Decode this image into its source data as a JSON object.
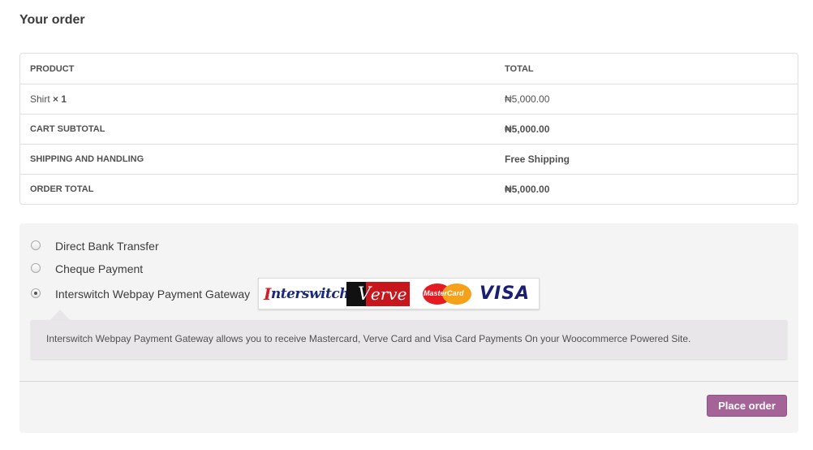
{
  "heading": "Your order",
  "table": {
    "header": {
      "product": "PRODUCT",
      "total": "TOTAL"
    },
    "item": {
      "name": "Shirt",
      "qty": "× 1",
      "total": "₦5,000.00"
    },
    "subtotal": {
      "label": "CART SUBTOTAL",
      "value": "₦5,000.00"
    },
    "shipping": {
      "label": "SHIPPING AND HANDLING",
      "value": "Free Shipping"
    },
    "order_total": {
      "label": "ORDER TOTAL",
      "value": "₦5,000.00"
    }
  },
  "payment": {
    "methods": [
      {
        "label": "Direct Bank Transfer",
        "selected": false
      },
      {
        "label": "Cheque Payment",
        "selected": false
      },
      {
        "label": "Interswitch Webpay Payment Gateway",
        "selected": true
      }
    ],
    "logos": {
      "interswitch_prefix": "I",
      "interswitch_text": "nterswitch",
      "verve": "erve",
      "mastercard": "MasterCard",
      "visa": "VISA"
    },
    "description": "Interswitch Webpay Payment Gateway allows you to receive Mastercard, Verve Card and Visa Card Payments On your Woocommerce Powered Site.",
    "place_order": "Place order"
  },
  "colors": {
    "button": "#a46497",
    "panel": "#f4f4f4",
    "description_box": "#e9e6ea"
  }
}
